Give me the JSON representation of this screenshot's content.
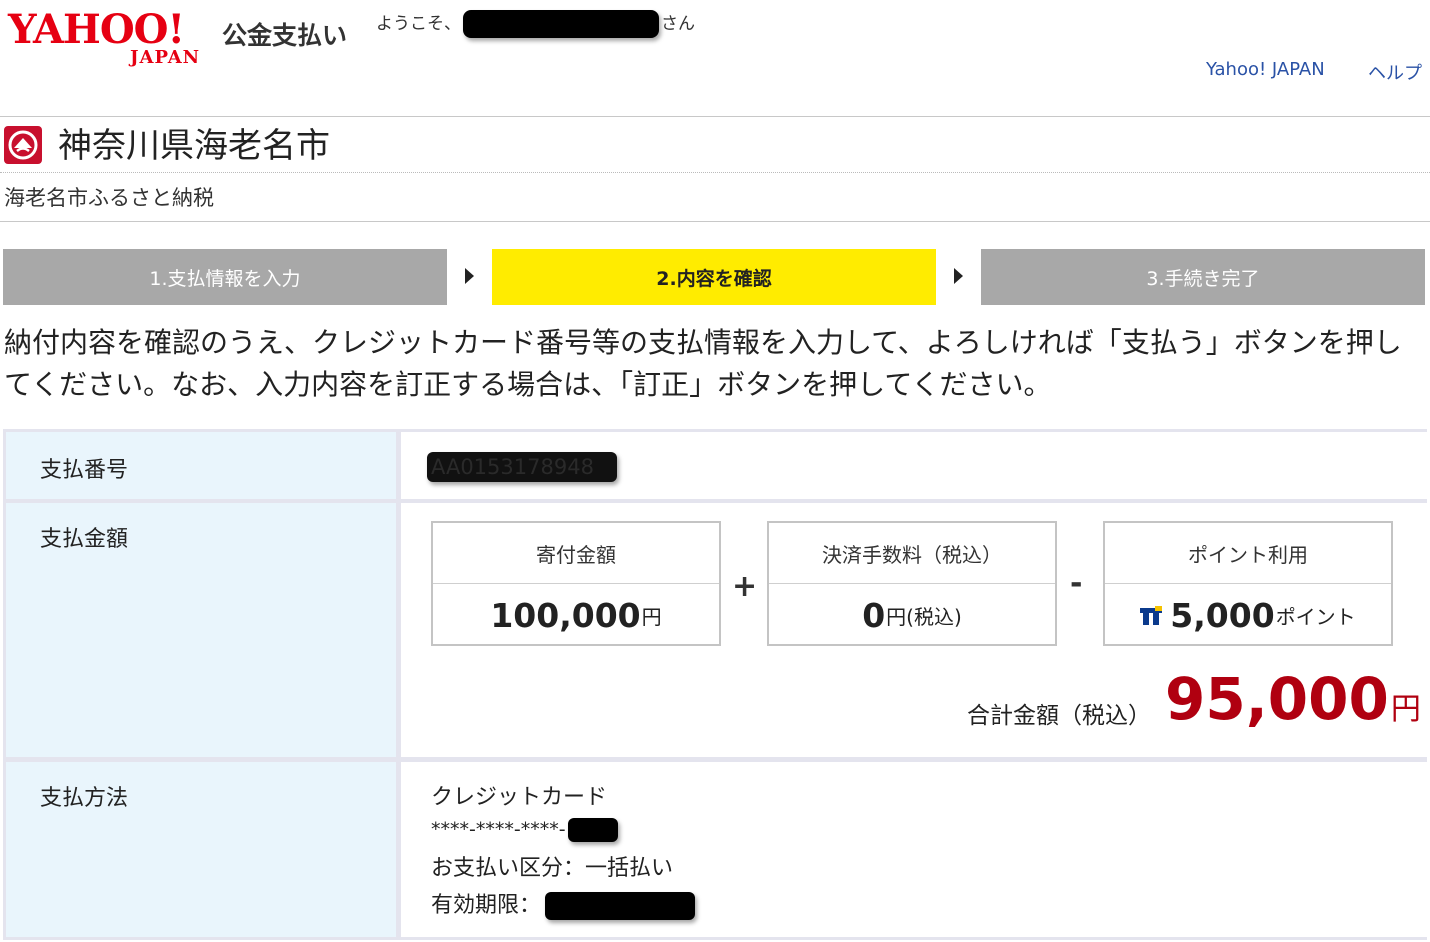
{
  "header": {
    "logo_main": "YAHOO!",
    "logo_sub": "JAPAN",
    "service_name": "公金支払い",
    "welcome_prefix": "ようこそ、",
    "welcome_suffix": "さん",
    "links": {
      "yahoo_japan": "Yahoo! JAPAN",
      "help": "ヘルプ"
    }
  },
  "organization": {
    "city_name": "神奈川県海老名市",
    "project_name": "海老名市ふるさと納税"
  },
  "steps": [
    {
      "label": "1.支払情報を入力",
      "state": "inactive"
    },
    {
      "label": "2.内容を確認",
      "state": "active"
    },
    {
      "label": "3.手続き完了",
      "state": "inactive"
    }
  ],
  "instructions": "納付内容を確認のうえ、クレジットカード番号等の支払情報を入力して、よろしければ「支払う」ボタンを押してください。なお、入力内容を訂正する場合は、「訂正」ボタンを押してください。",
  "details": {
    "payment_number_label": "支払番号",
    "payment_number_value": "AA0153178948",
    "amount_label": "支払金額",
    "donation": {
      "label": "寄付金額",
      "value": "100,000",
      "unit": "円"
    },
    "fee": {
      "label": "決済手数料（税込）",
      "value": "0",
      "unit": "円(税込)"
    },
    "points": {
      "label": "ポイント利用",
      "value": "5,000",
      "unit": "ポイント"
    },
    "plus_sign": "+",
    "minus_sign": "-",
    "total_label": "合計金額（税込）",
    "total_value": "95,000",
    "total_unit": "円",
    "method_label": "支払方法",
    "method_name": "クレジットカード",
    "card_masked": "****-****-****-",
    "installment": "お支払い区分：一括払い",
    "expiry_label": "有効期限："
  },
  "colors": {
    "brand_red": "#e60012",
    "active_step": "#ffec00",
    "inactive_step": "#a8a8a8",
    "total_red": "#b00010",
    "link_blue": "#2a52a6",
    "label_bg": "#e9f5fc"
  },
  "icons": {
    "city_emblem": "city-emblem-icon",
    "step_arrow": "triangle-right-icon",
    "t_point": "t-point-icon"
  }
}
